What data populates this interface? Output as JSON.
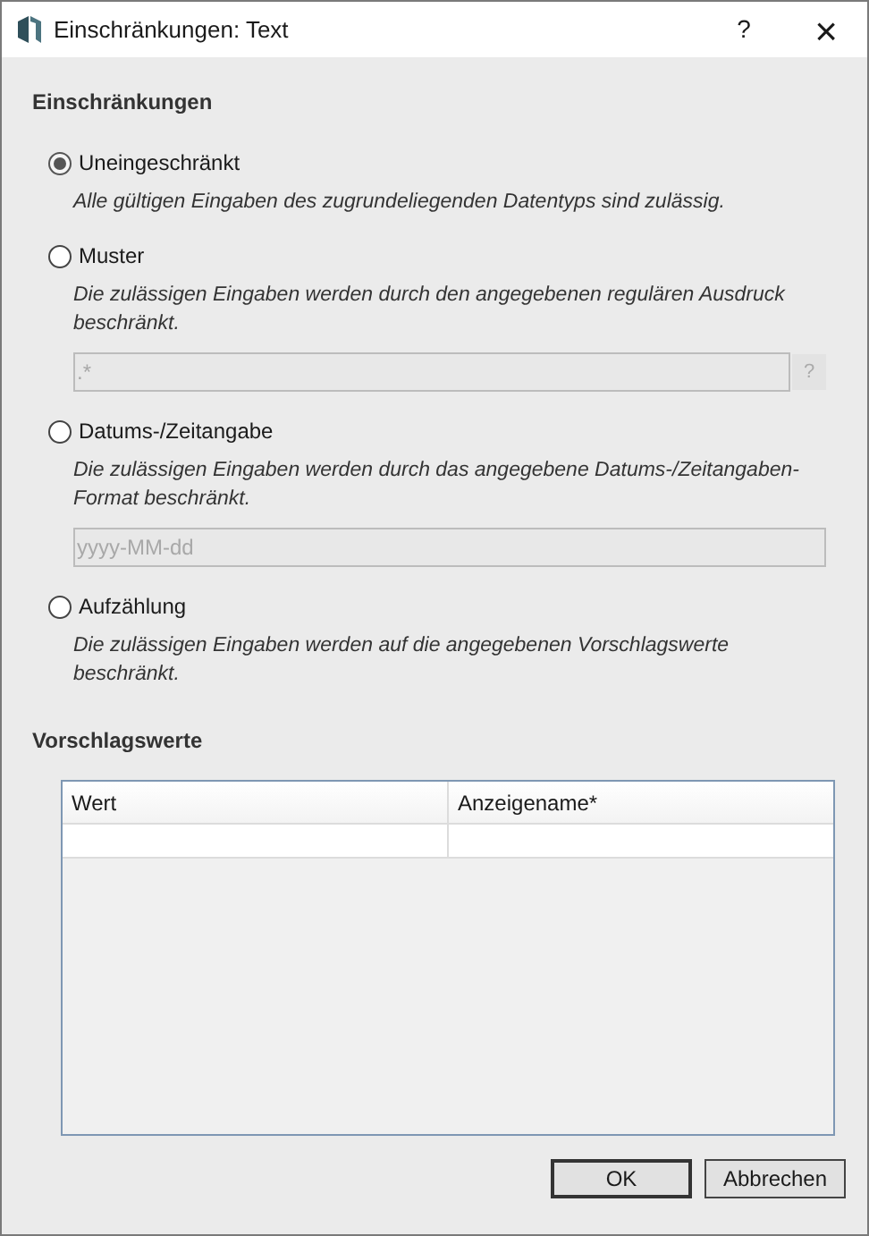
{
  "window": {
    "title": "Einschränkungen: Text",
    "help": "?",
    "close": "×"
  },
  "constraints": {
    "heading": "Einschränkungen",
    "options": [
      {
        "label": "Uneingeschränkt",
        "selected": true,
        "description": "Alle gültigen Eingaben des zugrundeliegenden Datentyps sind zulässig."
      },
      {
        "label": "Muster",
        "selected": false,
        "description": "Die zulässigen Eingaben werden durch den angegebenen regulären Ausdruck beschränkt.",
        "field": {
          "value": ".*",
          "disabled": true,
          "help": "?"
        }
      },
      {
        "label": "Datums-/Zeitangabe",
        "selected": false,
        "description": "Die zulässigen Eingaben werden durch das angegebene Datums-/Zeitangaben-Format beschränkt.",
        "field": {
          "value": "yyyy-MM-dd",
          "disabled": true
        }
      },
      {
        "label": "Aufzählung",
        "selected": false,
        "description": "Die zulässigen Eingaben werden auf die angegebenen Vorschlagswerte beschränkt."
      }
    ]
  },
  "suggestions": {
    "heading": "Vorschlagswerte",
    "columns": [
      "Wert",
      "Anzeigename*"
    ]
  },
  "buttons": [
    {
      "label": "OK",
      "default": true
    },
    {
      "label": "Abbrechen",
      "default": false
    }
  ]
}
